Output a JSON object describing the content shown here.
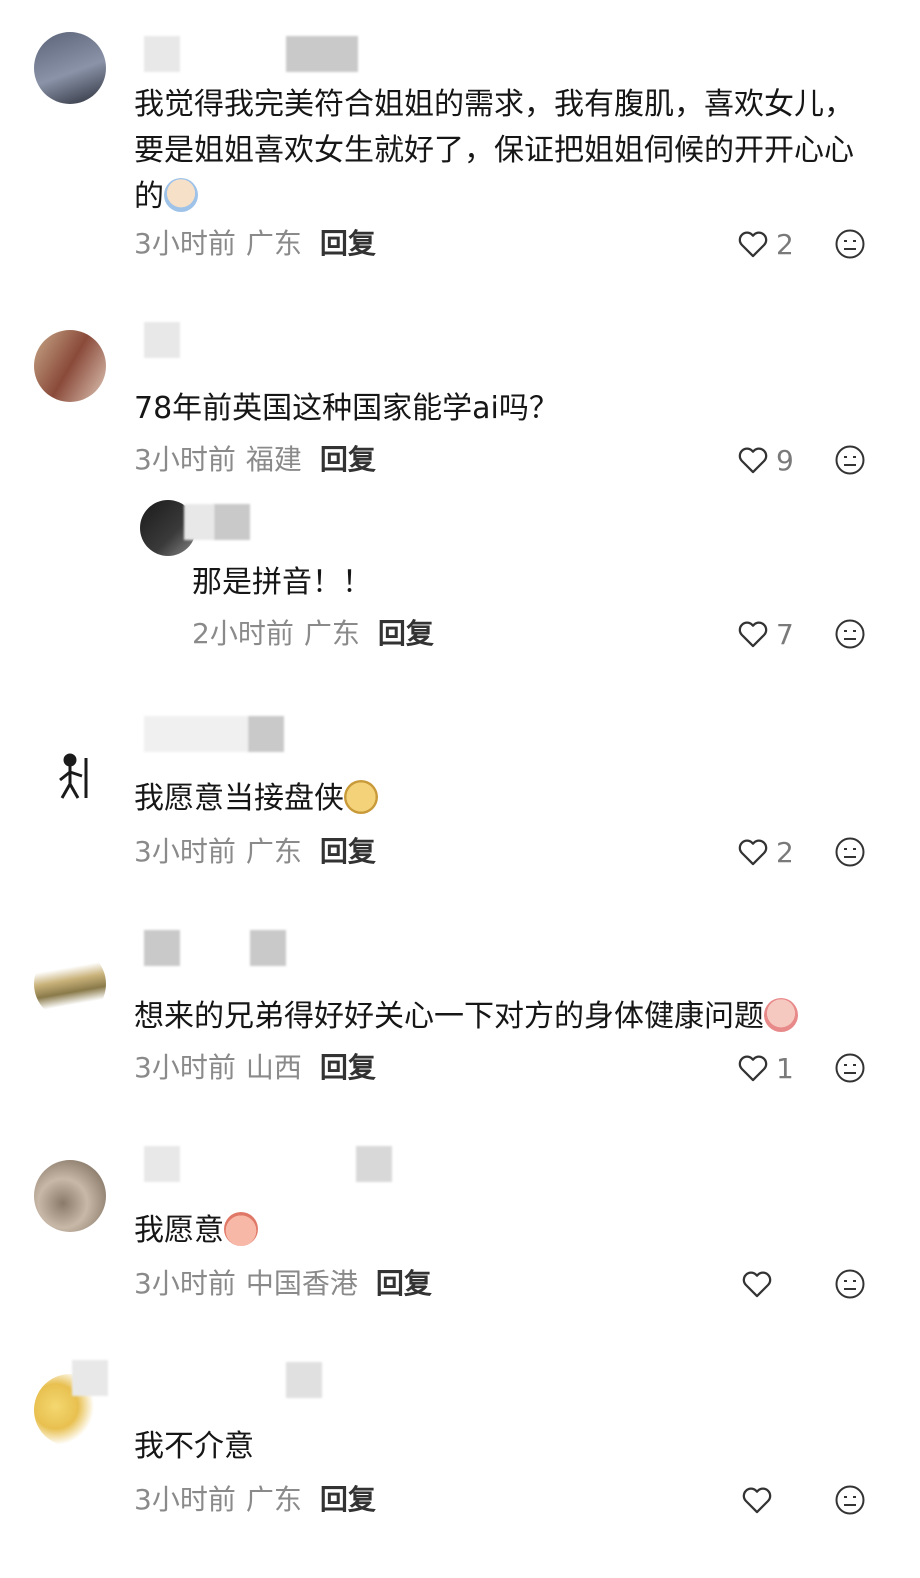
{
  "comments": [
    {
      "text": "我觉得我完美符合姐姐的需求，我有腹肌，喜欢女儿，要是姐姐喜欢女生就好了，保证把姐姐伺候的开开心心的",
      "emoji": "crying-face-emoji",
      "time": "3小时前",
      "location": "广东",
      "reply_label": "回复",
      "likes": "2"
    },
    {
      "text": "78年前英国这种国家能学ai吗？",
      "time": "3小时前",
      "location": "福建",
      "reply_label": "回复",
      "likes": "9"
    },
    {
      "text": "那是拼音！！",
      "time": "2小时前",
      "location": "广东",
      "reply_label": "回复",
      "likes": "7"
    },
    {
      "text": "我愿意当接盘侠",
      "emoji": "dog-face-emoji",
      "time": "3小时前",
      "location": "广东",
      "reply_label": "回复",
      "likes": "2"
    },
    {
      "text": "想来的兄弟得好好关心一下对方的身体健康问题",
      "emoji": "crying-face-emoji",
      "time": "3小时前",
      "location": "山西",
      "reply_label": "回复",
      "likes": "1"
    },
    {
      "text": "我愿意",
      "emoji": "peach-face-emoji",
      "time": "3小时前",
      "location": "中国香港",
      "reply_label": "回复",
      "likes": ""
    },
    {
      "text": "我不介意",
      "time": "3小时前",
      "location": "广东",
      "reply_label": "回复",
      "likes": ""
    }
  ],
  "colors": {
    "meta_gray": "#8a8a8a",
    "text_dark": "#161616",
    "icon_gray": "#333333"
  }
}
